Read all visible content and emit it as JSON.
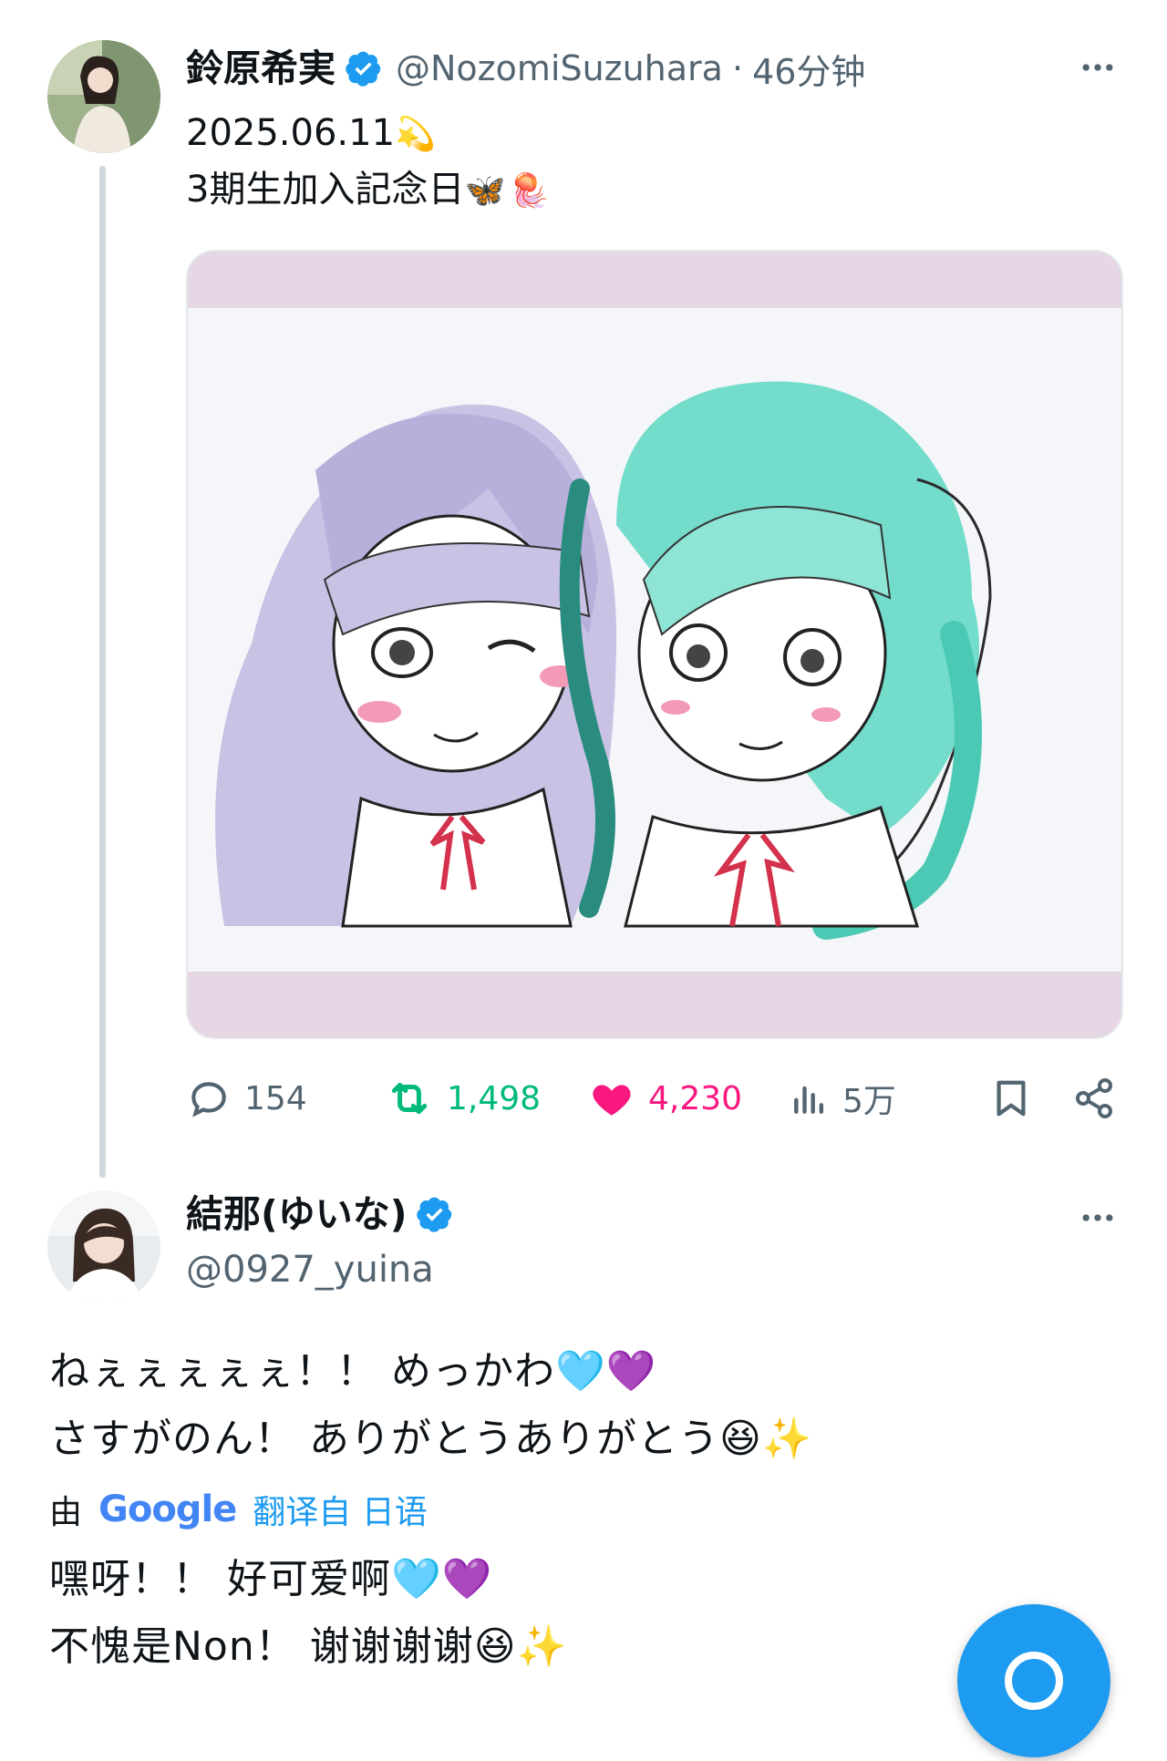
{
  "post": {
    "name": "鈴原希実",
    "handle": "@NozomiSuzuhara",
    "sep": "·",
    "time": "46分钟",
    "text_line1": "2025.06.11",
    "text_line2": "3期生加入記念日",
    "line1_emoji": "💫",
    "line2_emoji_1": "🦋",
    "line2_emoji_2": "🪼"
  },
  "actions": {
    "replies": "154",
    "reposts": "1,498",
    "likes": "4,230",
    "views": "5万"
  },
  "reply": {
    "name": "結那(ゆいな)",
    "handle": "@0927_yuina",
    "line1": "ねぇぇぇぇぇ！！ めっかわ",
    "line1_emoji_1": "🩵",
    "line1_emoji_2": "💜",
    "line2": "さすがのん！ ありがとうありがとう",
    "line2_emoji_1": "😆",
    "line2_emoji_2": "✨",
    "translate_prefix": "由",
    "translate_brand": "Google",
    "translate_label": "翻译自 日语",
    "trans_line1": "嘿呀！！ 好可爱啊",
    "trans_line2": "不愧是Non！ 谢谢谢谢"
  },
  "colors": {
    "accent": "#1d9bf0",
    "repost": "#00ba7c",
    "like": "#f91880",
    "muted": "#536471"
  },
  "icons": [
    "verified-badge-icon",
    "more-icon",
    "reply-icon",
    "repost-icon",
    "like-icon",
    "views-icon",
    "bookmark-icon",
    "share-icon",
    "compose-icon"
  ]
}
